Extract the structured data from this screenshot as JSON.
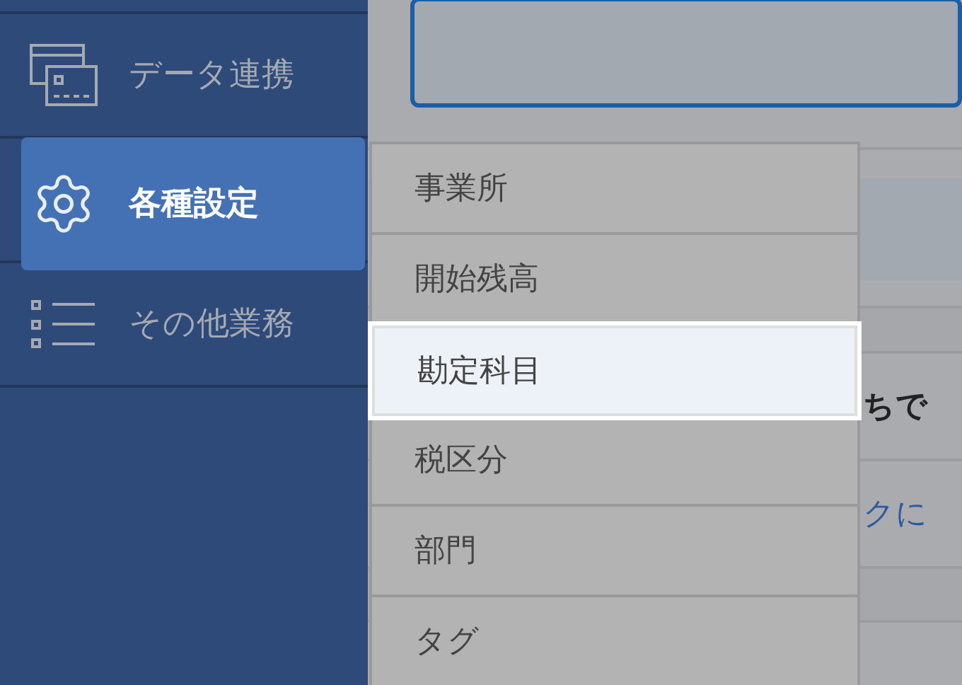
{
  "sidebar": {
    "items": [
      {
        "label": "データ連携",
        "kind": "cards",
        "selected": false
      },
      {
        "label": "各種設定",
        "kind": "gear",
        "selected": true
      },
      {
        "label": "その他業務",
        "kind": "list",
        "selected": false
      }
    ]
  },
  "content": {
    "texts": [
      {
        "text": "ちで",
        "kind": "bold"
      },
      {
        "text": "クに",
        "kind": "link"
      }
    ]
  },
  "submenu": {
    "items": [
      {
        "label": "事業所",
        "selected": false
      },
      {
        "label": "開始残高",
        "selected": false
      },
      {
        "label": "勘定科目",
        "selected": true
      },
      {
        "label": "税区分",
        "selected": false
      },
      {
        "label": "部門",
        "selected": false
      },
      {
        "label": "タグ",
        "selected": false
      }
    ]
  }
}
